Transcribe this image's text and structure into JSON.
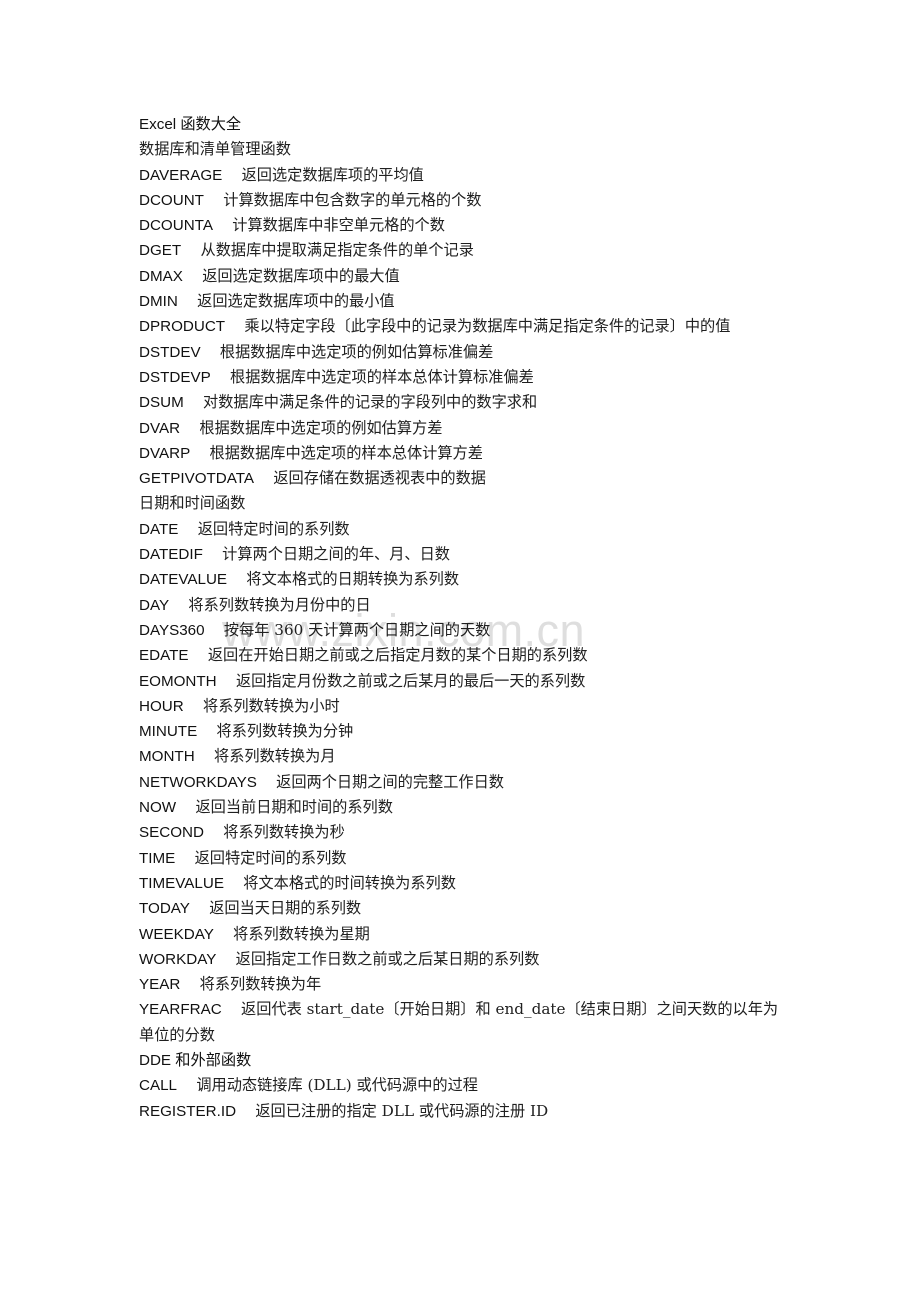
{
  "document": {
    "title": "Excel 函数大全",
    "watermark": "www.zixin.com.cn"
  },
  "lines": [
    {
      "type": "title",
      "name": "Excel 函数大全",
      "desc": ""
    },
    {
      "type": "section",
      "name": "数据库和清单管理函数",
      "desc": ""
    },
    {
      "type": "entry",
      "name": "DAVERAGE",
      "gap": "    ",
      "desc": "返回选定数据库项的平均值"
    },
    {
      "type": "entry",
      "name": "DCOUNT",
      "gap": "    ",
      "desc": "计算数据库中包含数字的单元格的个数"
    },
    {
      "type": "entry",
      "name": "DCOUNTA",
      "gap": "    ",
      "desc": "计算数据库中非空单元格的个数"
    },
    {
      "type": "entry",
      "name": "DGET",
      "gap": "    ",
      "desc": "从数据库中提取满足指定条件的单个记录"
    },
    {
      "type": "entry",
      "name": "DMAX",
      "gap": "    ",
      "desc": "返回选定数据库项中的最大值"
    },
    {
      "type": "entry",
      "name": "DMIN",
      "gap": "    ",
      "desc": "返回选定数据库项中的最小值"
    },
    {
      "type": "entry",
      "name": "DPRODUCT",
      "gap": "    ",
      "desc": "乘以特定字段〔此字段中的记录为数据库中满足指定条件的记录〕中的值"
    },
    {
      "type": "entry",
      "name": "DSTDEV",
      "gap": "    ",
      "desc": "根据数据库中选定项的例如估算标准偏差"
    },
    {
      "type": "entry",
      "name": "DSTDEVP",
      "gap": "    ",
      "desc": "根据数据库中选定项的样本总体计算标准偏差"
    },
    {
      "type": "entry",
      "name": "DSUM",
      "gap": "    ",
      "desc": "对数据库中满足条件的记录的字段列中的数字求和"
    },
    {
      "type": "entry",
      "name": "DVAR",
      "gap": "    ",
      "desc": "根据数据库中选定项的例如估算方差"
    },
    {
      "type": "entry",
      "name": "DVARP",
      "gap": "    ",
      "desc": "根据数据库中选定项的样本总体计算方差"
    },
    {
      "type": "entry",
      "name": "GETPIVOTDATA",
      "gap": "    ",
      "desc": "返回存储在数据透视表中的数据"
    },
    {
      "type": "section",
      "name": "日期和时间函数",
      "desc": ""
    },
    {
      "type": "entry",
      "name": "DATE",
      "gap": "    ",
      "desc": "返回特定时间的系列数"
    },
    {
      "type": "entry",
      "name": "DATEDIF",
      "gap": "    ",
      "desc": "计算两个日期之间的年、月、日数"
    },
    {
      "type": "entry",
      "name": "DATEVALUE",
      "gap": "    ",
      "desc": "将文本格式的日期转换为系列数"
    },
    {
      "type": "entry",
      "name": "DAY",
      "gap": "    ",
      "desc": "将系列数转换为月份中的日"
    },
    {
      "type": "entry",
      "name": "DAYS360",
      "gap": "    ",
      "desc": "按每年 360 天计算两个日期之间的天数"
    },
    {
      "type": "entry",
      "name": "EDATE",
      "gap": "    ",
      "desc": "返回在开始日期之前或之后指定月数的某个日期的系列数"
    },
    {
      "type": "entry",
      "name": "EOMONTH",
      "gap": "    ",
      "desc": "返回指定月份数之前或之后某月的最后一天的系列数"
    },
    {
      "type": "entry",
      "name": "HOUR",
      "gap": "    ",
      "desc": "将系列数转换为小时"
    },
    {
      "type": "entry",
      "name": "MINUTE",
      "gap": "    ",
      "desc": "将系列数转换为分钟"
    },
    {
      "type": "entry",
      "name": "MONTH",
      "gap": "    ",
      "desc": "将系列数转换为月"
    },
    {
      "type": "entry",
      "name": "NETWORKDAYS",
      "gap": "    ",
      "desc": "返回两个日期之间的完整工作日数"
    },
    {
      "type": "entry",
      "name": "NOW",
      "gap": "    ",
      "desc": "返回当前日期和时间的系列数"
    },
    {
      "type": "entry",
      "name": "SECOND",
      "gap": "    ",
      "desc": "将系列数转换为秒"
    },
    {
      "type": "entry",
      "name": "TIME",
      "gap": "    ",
      "desc": "返回特定时间的系列数"
    },
    {
      "type": "entry",
      "name": "TIMEVALUE",
      "gap": "    ",
      "desc": "将文本格式的时间转换为系列数"
    },
    {
      "type": "entry",
      "name": "TODAY",
      "gap": "    ",
      "desc": "返回当天日期的系列数"
    },
    {
      "type": "entry",
      "name": "WEEKDAY",
      "gap": "    ",
      "desc": "将系列数转换为星期"
    },
    {
      "type": "entry",
      "name": "WORKDAY",
      "gap": "    ",
      "desc": "返回指定工作日数之前或之后某日期的系列数"
    },
    {
      "type": "entry",
      "name": "YEAR",
      "gap": "    ",
      "desc": "将系列数转换为年"
    },
    {
      "type": "entry",
      "name": "YEARFRAC",
      "gap": "    ",
      "desc": "返回代表 start_date〔开始日期〕和 end_date〔结束日期〕之间天数的以年为单位的分数"
    },
    {
      "type": "section",
      "name": "DDE 和外部函数",
      "desc": ""
    },
    {
      "type": "entry",
      "name": "CALL",
      "gap": "    ",
      "desc": "调用动态链接库 (DLL) 或代码源中的过程"
    },
    {
      "type": "entry",
      "name": "REGISTER.ID",
      "gap": "    ",
      "desc": "返回已注册的指定 DLL 或代码源的注册 ID"
    }
  ]
}
